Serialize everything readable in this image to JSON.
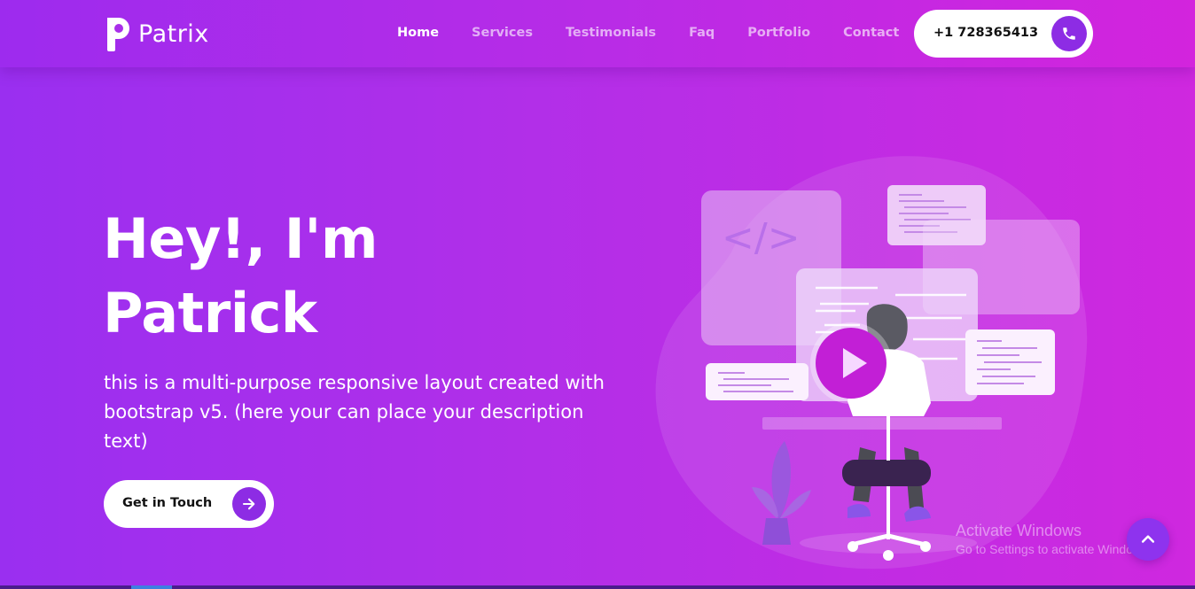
{
  "brand": {
    "name": "Patrix",
    "logo_icon": "p-letter-logo-icon"
  },
  "nav": {
    "items": [
      {
        "label": "Home",
        "active": true
      },
      {
        "label": "Services",
        "active": false
      },
      {
        "label": "Testimonials",
        "active": false
      },
      {
        "label": "Faq",
        "active": false
      },
      {
        "label": "Portfolio",
        "active": false
      },
      {
        "label": "Contact",
        "active": false
      }
    ],
    "phone": {
      "number": "+1 728365413",
      "icon": "phone-icon"
    }
  },
  "hero": {
    "title_line1": "Hey!, I'm",
    "title_line2": "Patrick",
    "description": "this is a multi-purpose responsive layout created with bootstrap v5. (here your can place your description text)",
    "cta": {
      "label": "Get in Touch",
      "icon": "arrow-right-icon"
    },
    "illustration_code_tag": "</>",
    "play_icon": "play-icon"
  },
  "watermark": {
    "title": "Activate Windows",
    "subtitle": "Go to Settings to activate Windows."
  },
  "scroll_top": {
    "icon": "chevron-up-icon"
  },
  "colors": {
    "accent": "#8d2ce4",
    "gradient_start": "#9a2ff0",
    "gradient_end": "#cf28df",
    "play": "#c21fd6"
  }
}
